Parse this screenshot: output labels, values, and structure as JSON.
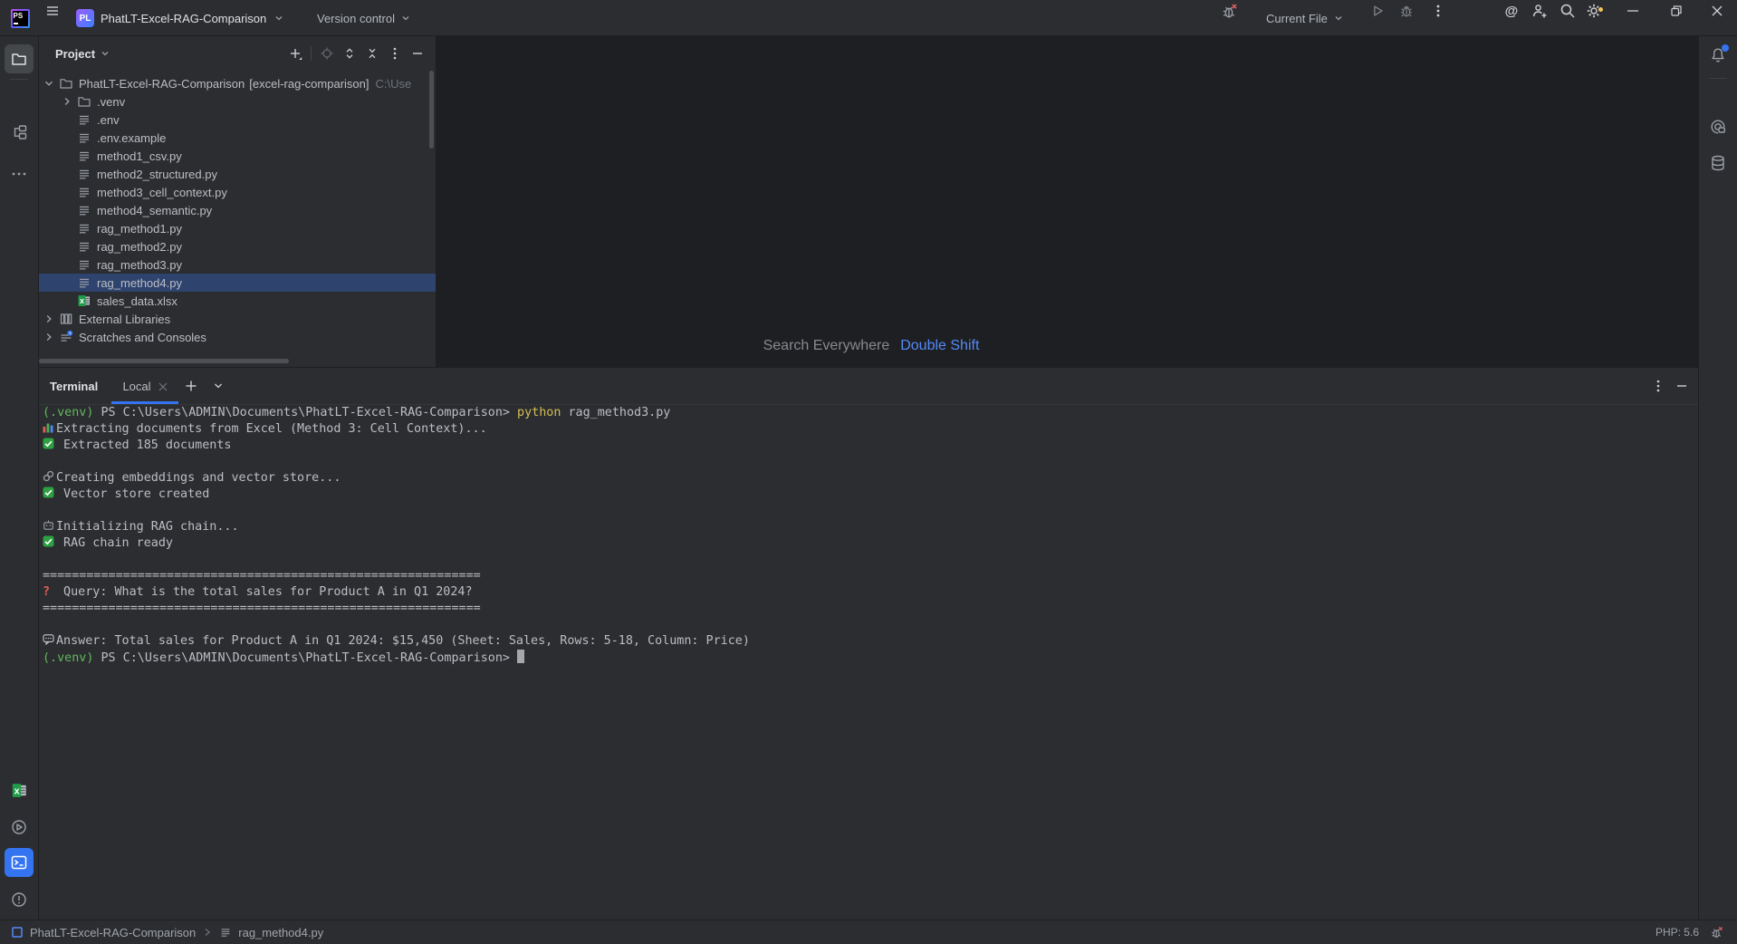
{
  "colors": {
    "accent_blue": "#3574f0",
    "link_blue": "#548af7",
    "selection_blue": "#2e436e",
    "terminal_green": "#62b95c",
    "terminal_yellow": "#d6bf55",
    "success_green": "#2ea043",
    "error_red": "#e05f59",
    "settings_badge_yellow": "#f2c55c"
  },
  "titlebar": {
    "app_logo": "PS",
    "project_avatar": "PL",
    "project_name": "PhatLT-Excel-RAG-Comparison",
    "version_control_label": "Version control",
    "run_config_label": "Current File"
  },
  "project_panel": {
    "title": "Project",
    "tree": [
      {
        "label": "PhatLT-Excel-RAG-Comparison",
        "suffix": "[excel-rag-comparison]",
        "path_hint": "C:\\Use",
        "icon": "folder",
        "level": 0,
        "chevron": "down"
      },
      {
        "label": ".venv",
        "icon": "folder",
        "level": 1,
        "chevron": "right"
      },
      {
        "label": ".env",
        "icon": "file",
        "level": 1
      },
      {
        "label": ".env.example",
        "icon": "file",
        "level": 1
      },
      {
        "label": "method1_csv.py",
        "icon": "file",
        "level": 1
      },
      {
        "label": "method2_structured.py",
        "icon": "file",
        "level": 1
      },
      {
        "label": "method3_cell_context.py",
        "icon": "file",
        "level": 1
      },
      {
        "label": "method4_semantic.py",
        "icon": "file",
        "level": 1
      },
      {
        "label": "rag_method1.py",
        "icon": "file",
        "level": 1
      },
      {
        "label": "rag_method2.py",
        "icon": "file",
        "level": 1
      },
      {
        "label": "rag_method3.py",
        "icon": "file",
        "level": 1
      },
      {
        "label": "rag_method4.py",
        "icon": "file",
        "level": 1,
        "selected": true
      },
      {
        "label": "sales_data.xlsx",
        "icon": "excel",
        "level": 1
      },
      {
        "label": "External Libraries",
        "icon": "library",
        "level": 0,
        "chevron": "right"
      },
      {
        "label": "Scratches and Consoles",
        "icon": "scratch",
        "level": 0,
        "chevron": "right"
      }
    ]
  },
  "editor": {
    "hint_label": "Search Everywhere",
    "hint_shortcut": "Double Shift"
  },
  "terminal": {
    "panel_title": "Terminal",
    "tab_label": "Local",
    "lines": [
      [
        {
          "t": "(.venv)",
          "c": "green"
        },
        {
          "t": " PS C:\\Users\\ADMIN\\Documents\\PhatLT-Excel-RAG-Comparison> ",
          "c": "fg"
        },
        {
          "t": "python",
          "c": "yellow"
        },
        {
          "t": " rag_method3.py",
          "c": "fg"
        }
      ],
      [
        {
          "ic": "chart"
        },
        {
          "t": "Extracting documents from Excel (Method 3: Cell Context)...",
          "c": "fg"
        }
      ],
      [
        {
          "ic": "check"
        },
        {
          "t": " Extracted 185 documents",
          "c": "fg"
        }
      ],
      [],
      [
        {
          "ic": "link"
        },
        {
          "t": "Creating embeddings and vector store...",
          "c": "fg"
        }
      ],
      [
        {
          "ic": "check"
        },
        {
          "t": " Vector store created",
          "c": "fg"
        }
      ],
      [],
      [
        {
          "ic": "robot"
        },
        {
          "t": "Initializing RAG chain...",
          "c": "fg"
        }
      ],
      [
        {
          "ic": "check"
        },
        {
          "t": " RAG chain ready",
          "c": "fg"
        }
      ],
      [],
      [
        {
          "t": "============================================================",
          "c": "fg"
        }
      ],
      [
        {
          "ic": "question"
        },
        {
          "t": " Query: What is the total sales for Product A in Q1 2024?",
          "c": "fg"
        }
      ],
      [
        {
          "t": "============================================================",
          "c": "fg"
        }
      ],
      [],
      [
        {
          "ic": "speech"
        },
        {
          "t": "Answer: Total sales for Product A in Q1 2024: $15,450 (Sheet: Sales, Rows: 5-18, Column: Price)",
          "c": "fg"
        }
      ],
      [
        {
          "t": "(.venv)",
          "c": "green"
        },
        {
          "t": " PS C:\\Users\\ADMIN\\Documents\\PhatLT-Excel-RAG-Comparison> ",
          "c": "fg"
        },
        {
          "cursor": true
        }
      ]
    ]
  },
  "statusbar": {
    "breadcrumb_project": "PhatLT-Excel-RAG-Comparison",
    "breadcrumb_file": "rag_method4.py",
    "php_version": "PHP: 5.6"
  }
}
